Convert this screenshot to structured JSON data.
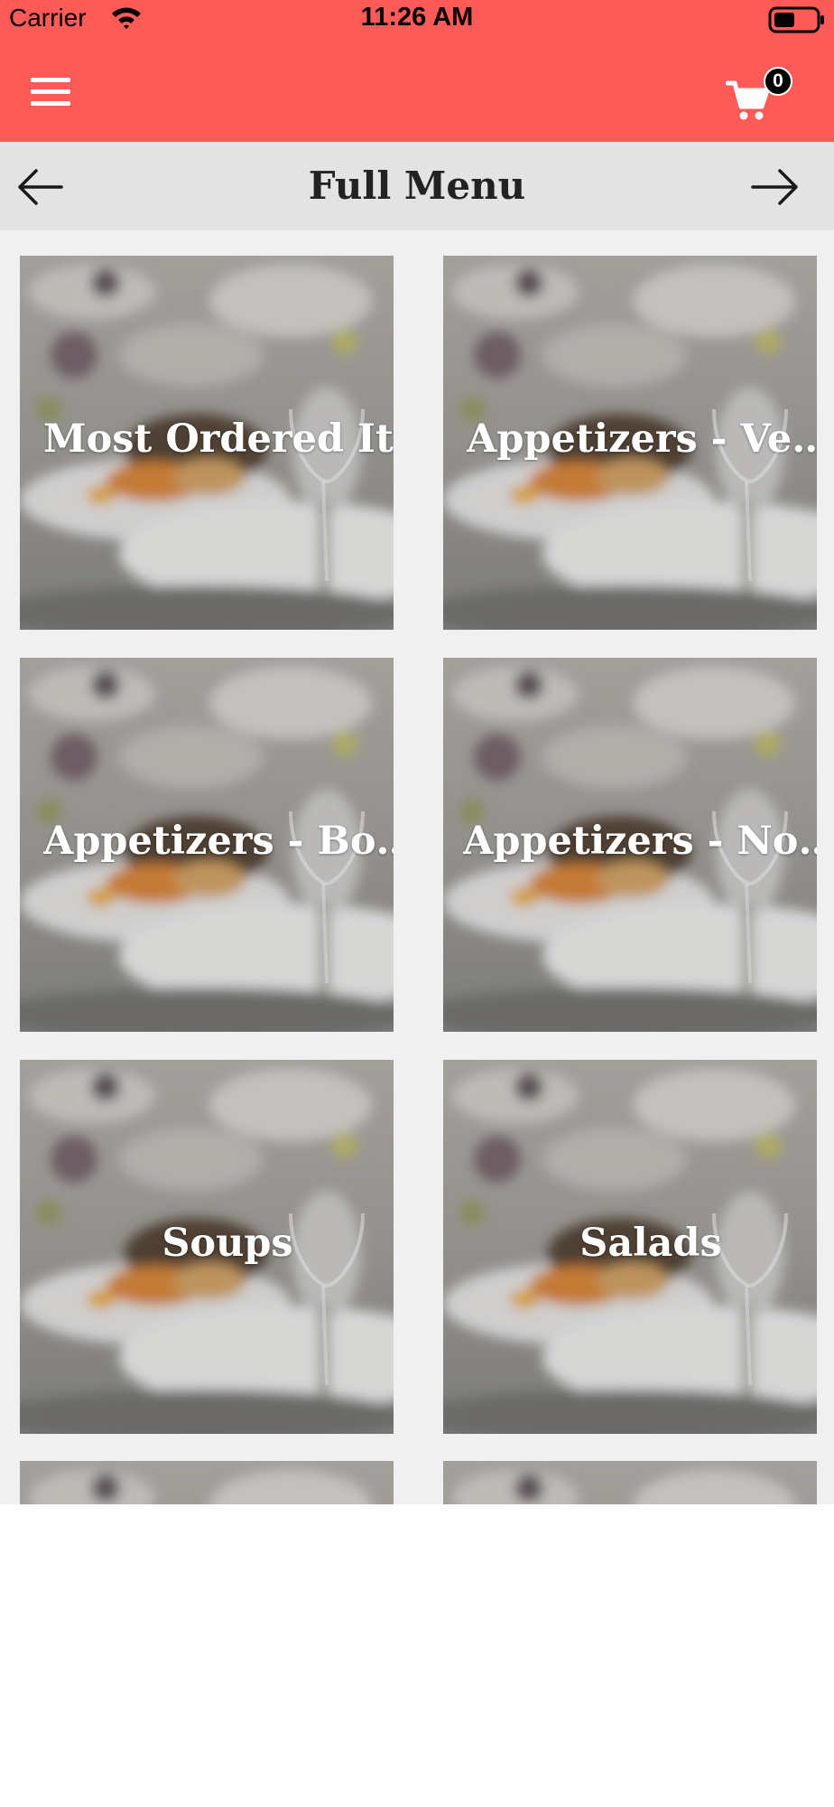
{
  "status_bar": {
    "carrier": "Carrier",
    "time": "11:26 AM"
  },
  "app_bar": {
    "menu_icon": "hamburger-menu-icon",
    "cart_icon": "shopping-cart-icon",
    "cart_count": "0",
    "background_color": "#fd5a58"
  },
  "title_bar": {
    "title": "Full Menu",
    "prev_icon": "arrow-left-icon",
    "next_icon": "arrow-right-icon"
  },
  "categories": [
    {
      "label": "Most Ordered Items"
    },
    {
      "label": "Appetizers - Vegetarian"
    },
    {
      "label": "Appetizers - Bombay Street Food"
    },
    {
      "label": "Appetizers - Non-Vegetarian"
    },
    {
      "label": "Soups"
    },
    {
      "label": "Salads"
    },
    {
      "label": ""
    },
    {
      "label": ""
    }
  ]
}
